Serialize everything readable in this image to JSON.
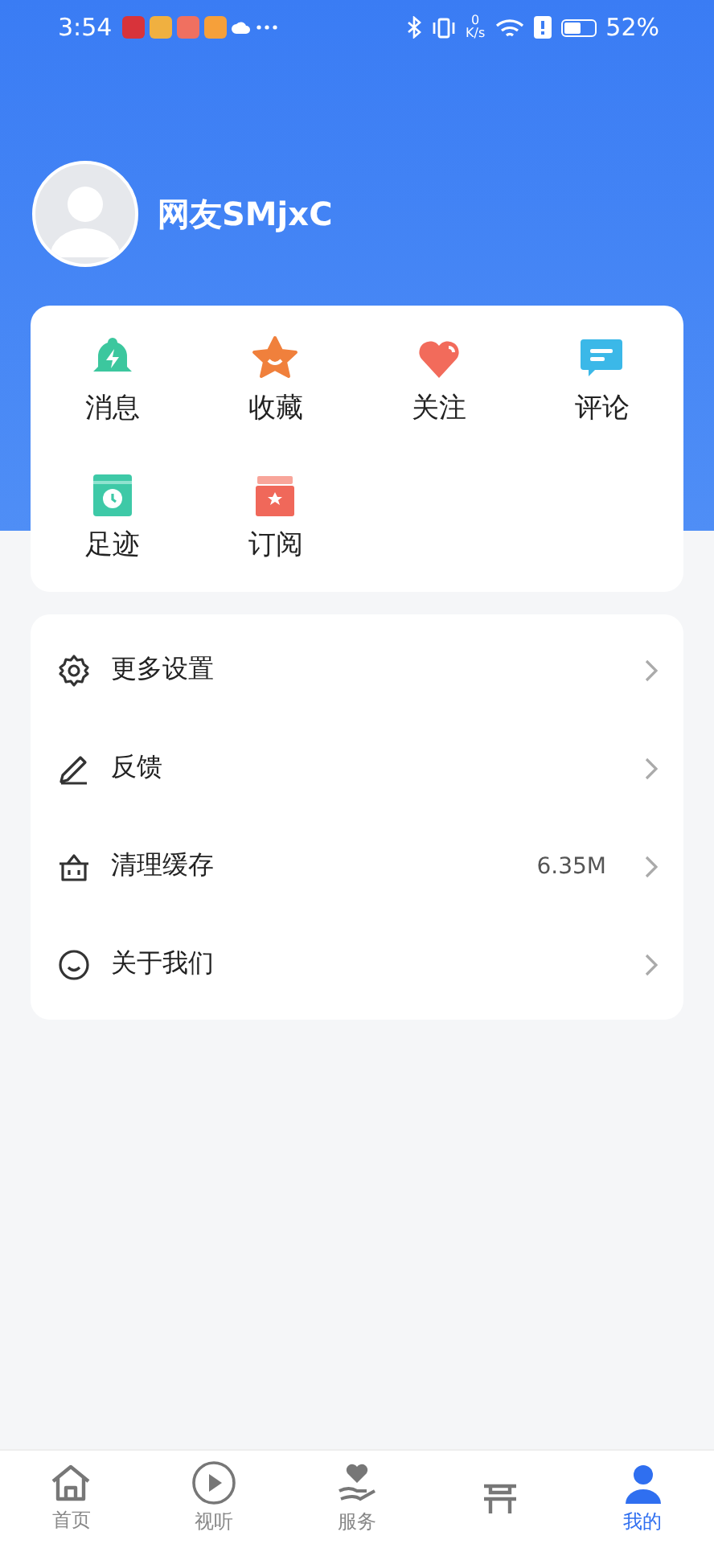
{
  "status_bar": {
    "time": "3:54",
    "speed": "0\nK/s",
    "battery": "52%"
  },
  "profile": {
    "name": "网友SMjxC"
  },
  "shortcuts": [
    {
      "label": "消息",
      "kind": "bell"
    },
    {
      "label": "收藏",
      "kind": "star"
    },
    {
      "label": "关注",
      "kind": "heart"
    },
    {
      "label": "评论",
      "kind": "comment"
    },
    {
      "label": "足迹",
      "kind": "clock"
    },
    {
      "label": "订阅",
      "kind": "box"
    }
  ],
  "menu": [
    {
      "label": "更多设置",
      "kind": "gear"
    },
    {
      "label": "反馈",
      "kind": "pen"
    },
    {
      "label": "清理缓存",
      "kind": "basket",
      "value": "6.35M"
    },
    {
      "label": "关于我们",
      "kind": "smile"
    }
  ],
  "tabs": [
    {
      "label": "首页",
      "kind": "home",
      "selected": false
    },
    {
      "label": "视听",
      "kind": "play",
      "selected": false
    },
    {
      "label": "服务",
      "kind": "hand",
      "selected": false
    },
    {
      "kind": "seat",
      "selected": false
    },
    {
      "label": "我的",
      "kind": "person",
      "selected": true
    }
  ]
}
